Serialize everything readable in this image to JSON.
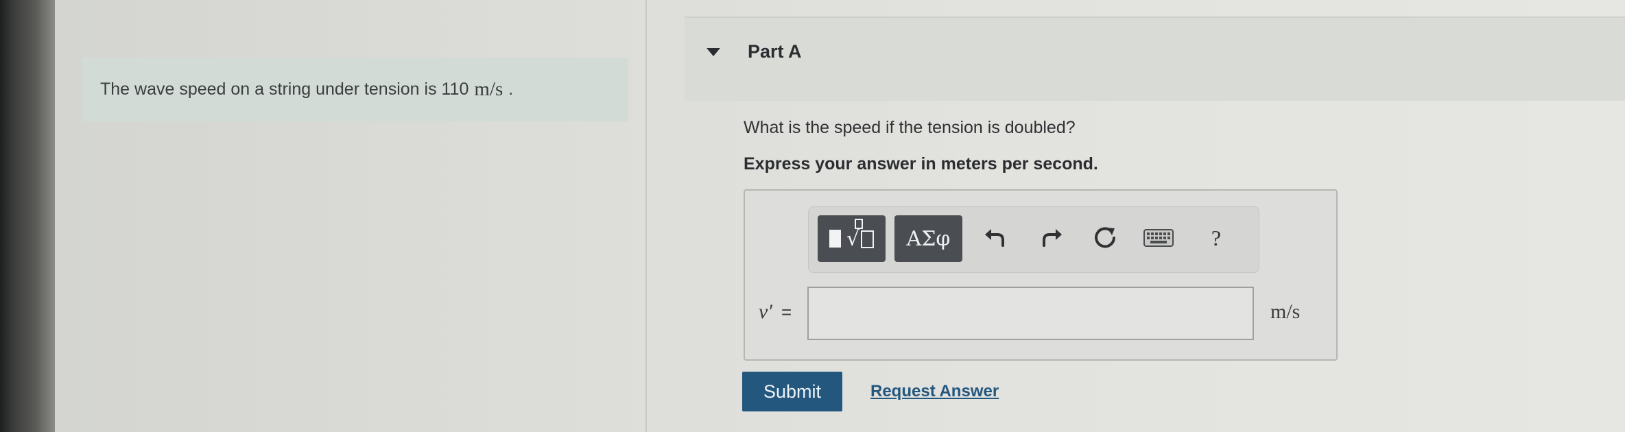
{
  "problem": {
    "statement": "The wave speed on a string under tension is 110",
    "unit": "m/s",
    "period": "."
  },
  "part": {
    "title": "Part A",
    "question": "What is the speed if the tension is doubled?",
    "instruction": "Express your answer in meters per second."
  },
  "toolbar": {
    "greek_label": "ΑΣφ",
    "help_label": "?",
    "icons": [
      "templates-icon",
      "greek-symbols-icon",
      "undo-icon",
      "redo-icon",
      "reset-icon",
      "keyboard-icon",
      "help-icon"
    ]
  },
  "answer": {
    "variable": "v′",
    "equals": "=",
    "value": "",
    "unit": "m/s"
  },
  "actions": {
    "submit_label": "Submit",
    "request_label": "Request Answer"
  },
  "colors": {
    "primary_button": "#23577e",
    "link": "#23577e",
    "problem_box_bg": "#d2dbd6"
  }
}
